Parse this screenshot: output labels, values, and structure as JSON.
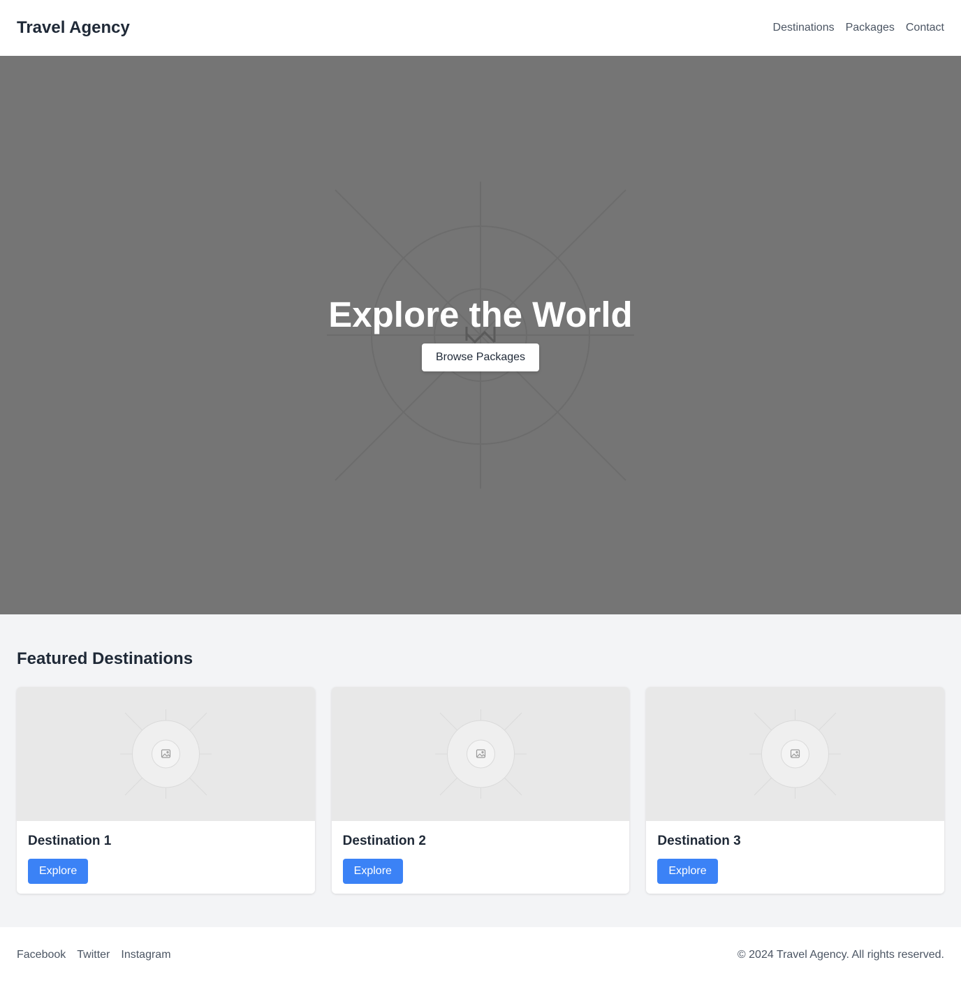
{
  "header": {
    "brand": "Travel Agency",
    "nav": [
      "Destinations",
      "Packages",
      "Contact"
    ]
  },
  "hero": {
    "title": "Explore the World",
    "button_label": "Browse Packages",
    "image_icon": "image-placeholder-icon"
  },
  "featured": {
    "title": "Featured Destinations",
    "cards": [
      {
        "title": "Destination 1",
        "button_label": "Explore"
      },
      {
        "title": "Destination 2",
        "button_label": "Explore"
      },
      {
        "title": "Destination 3",
        "button_label": "Explore"
      }
    ]
  },
  "footer": {
    "social": [
      "Facebook",
      "Twitter",
      "Instagram"
    ],
    "copyright": "© 2024 Travel Agency. All rights reserved."
  },
  "colors": {
    "accent": "#3b82f6",
    "hero_bg": "#757575",
    "page_bg": "#f3f4f6"
  }
}
